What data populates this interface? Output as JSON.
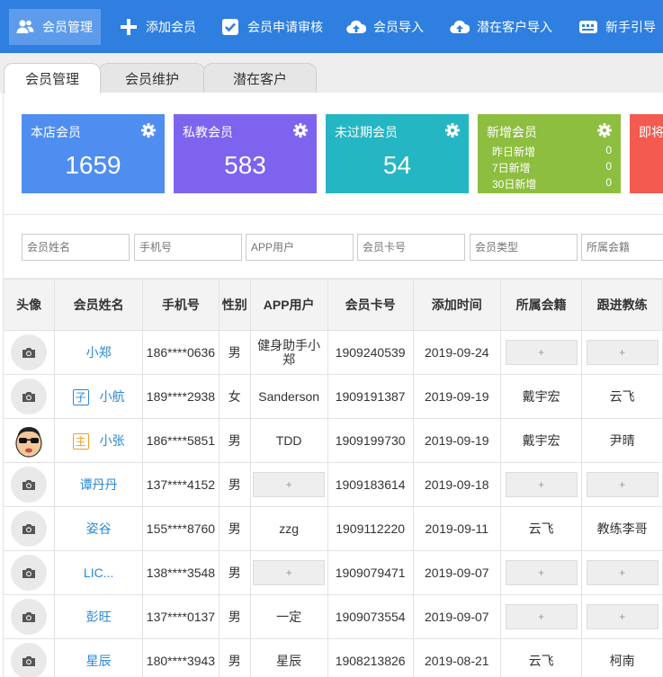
{
  "toolbar": {
    "items": [
      {
        "label": "会员管理",
        "icon": "users-icon",
        "active": true
      },
      {
        "label": "添加会员",
        "icon": "plus-icon"
      },
      {
        "label": "会员申请审核",
        "icon": "checkbox-icon"
      },
      {
        "label": "会员导入",
        "icon": "cloud-upload-icon"
      },
      {
        "label": "潜在客户导入",
        "icon": "cloud-upload-icon"
      },
      {
        "label": "新手引导",
        "icon": "guide-icon"
      }
    ]
  },
  "tabs": [
    {
      "label": "会员管理",
      "active": true
    },
    {
      "label": "会员维护"
    },
    {
      "label": "潜在客户"
    }
  ],
  "cards": [
    {
      "title": "本店会员",
      "value": "1659",
      "color": "#4f8ef0"
    },
    {
      "title": "私教会员",
      "value": "583",
      "color": "#7e63ee"
    },
    {
      "title": "未过期会员",
      "value": "54",
      "color": "#25b6c3"
    },
    {
      "title": "新增会员",
      "color": "#8dbe3f",
      "rows": [
        {
          "label": "昨日新增",
          "value": "0"
        },
        {
          "label": "7日新增",
          "value": "0"
        },
        {
          "label": "30日新增",
          "value": "0"
        }
      ]
    },
    {
      "title": "即将",
      "color": "#f35b50"
    }
  ],
  "filters": [
    {
      "placeholder": "会员姓名"
    },
    {
      "placeholder": "手机号"
    },
    {
      "placeholder": "APP用户"
    },
    {
      "placeholder": "会员卡号"
    },
    {
      "placeholder": "会员类型"
    },
    {
      "placeholder": "所属会籍"
    }
  ],
  "table": {
    "headers": [
      "头像",
      "会员姓名",
      "手机号",
      "性别",
      "APP用户",
      "会员卡号",
      "添加时间",
      "所属会籍",
      "跟进教练"
    ],
    "plus_label": "+",
    "rows": [
      {
        "name": "小郑",
        "badge": "",
        "phone": "186****0636",
        "gender": "男",
        "app": "健身助手小郑",
        "card": "1909240539",
        "date": "2019-09-24",
        "club": "",
        "coach": ""
      },
      {
        "name": "小航",
        "badge": "子",
        "phone": "189****2938",
        "gender": "女",
        "app": "Sanderson",
        "card": "1909191387",
        "date": "2019-09-19",
        "club": "戴宇宏",
        "coach": "云飞"
      },
      {
        "name": "小张",
        "badge": "主",
        "phone": "186****5851",
        "gender": "男",
        "app": "TDD",
        "card": "1909199730",
        "date": "2019-09-19",
        "club": "戴宇宏",
        "coach": "尹晴"
      },
      {
        "name": "谭丹丹",
        "badge": "",
        "phone": "137****4152",
        "gender": "男",
        "app": "",
        "card": "1909183614",
        "date": "2019-09-18",
        "club": "",
        "coach": ""
      },
      {
        "name": "姿谷",
        "badge": "",
        "phone": "155****8760",
        "gender": "男",
        "app": "zzg",
        "card": "1909112220",
        "date": "2019-09-11",
        "club": "云飞",
        "coach": "教练李哥"
      },
      {
        "name": "LIC...",
        "badge": "",
        "phone": "138****3548",
        "gender": "男",
        "app": "",
        "card": "1909079471",
        "date": "2019-09-07",
        "club": "",
        "coach": ""
      },
      {
        "name": "彭旺",
        "badge": "",
        "phone": "137****0137",
        "gender": "男",
        "app": "一定",
        "card": "1909073554",
        "date": "2019-09-07",
        "club": "",
        "coach": ""
      },
      {
        "name": "星辰",
        "badge": "",
        "phone": "180****3943",
        "gender": "男",
        "app": "星辰",
        "card": "1908213826",
        "date": "2019-08-21",
        "club": "云飞",
        "coach": "柯南"
      }
    ]
  }
}
